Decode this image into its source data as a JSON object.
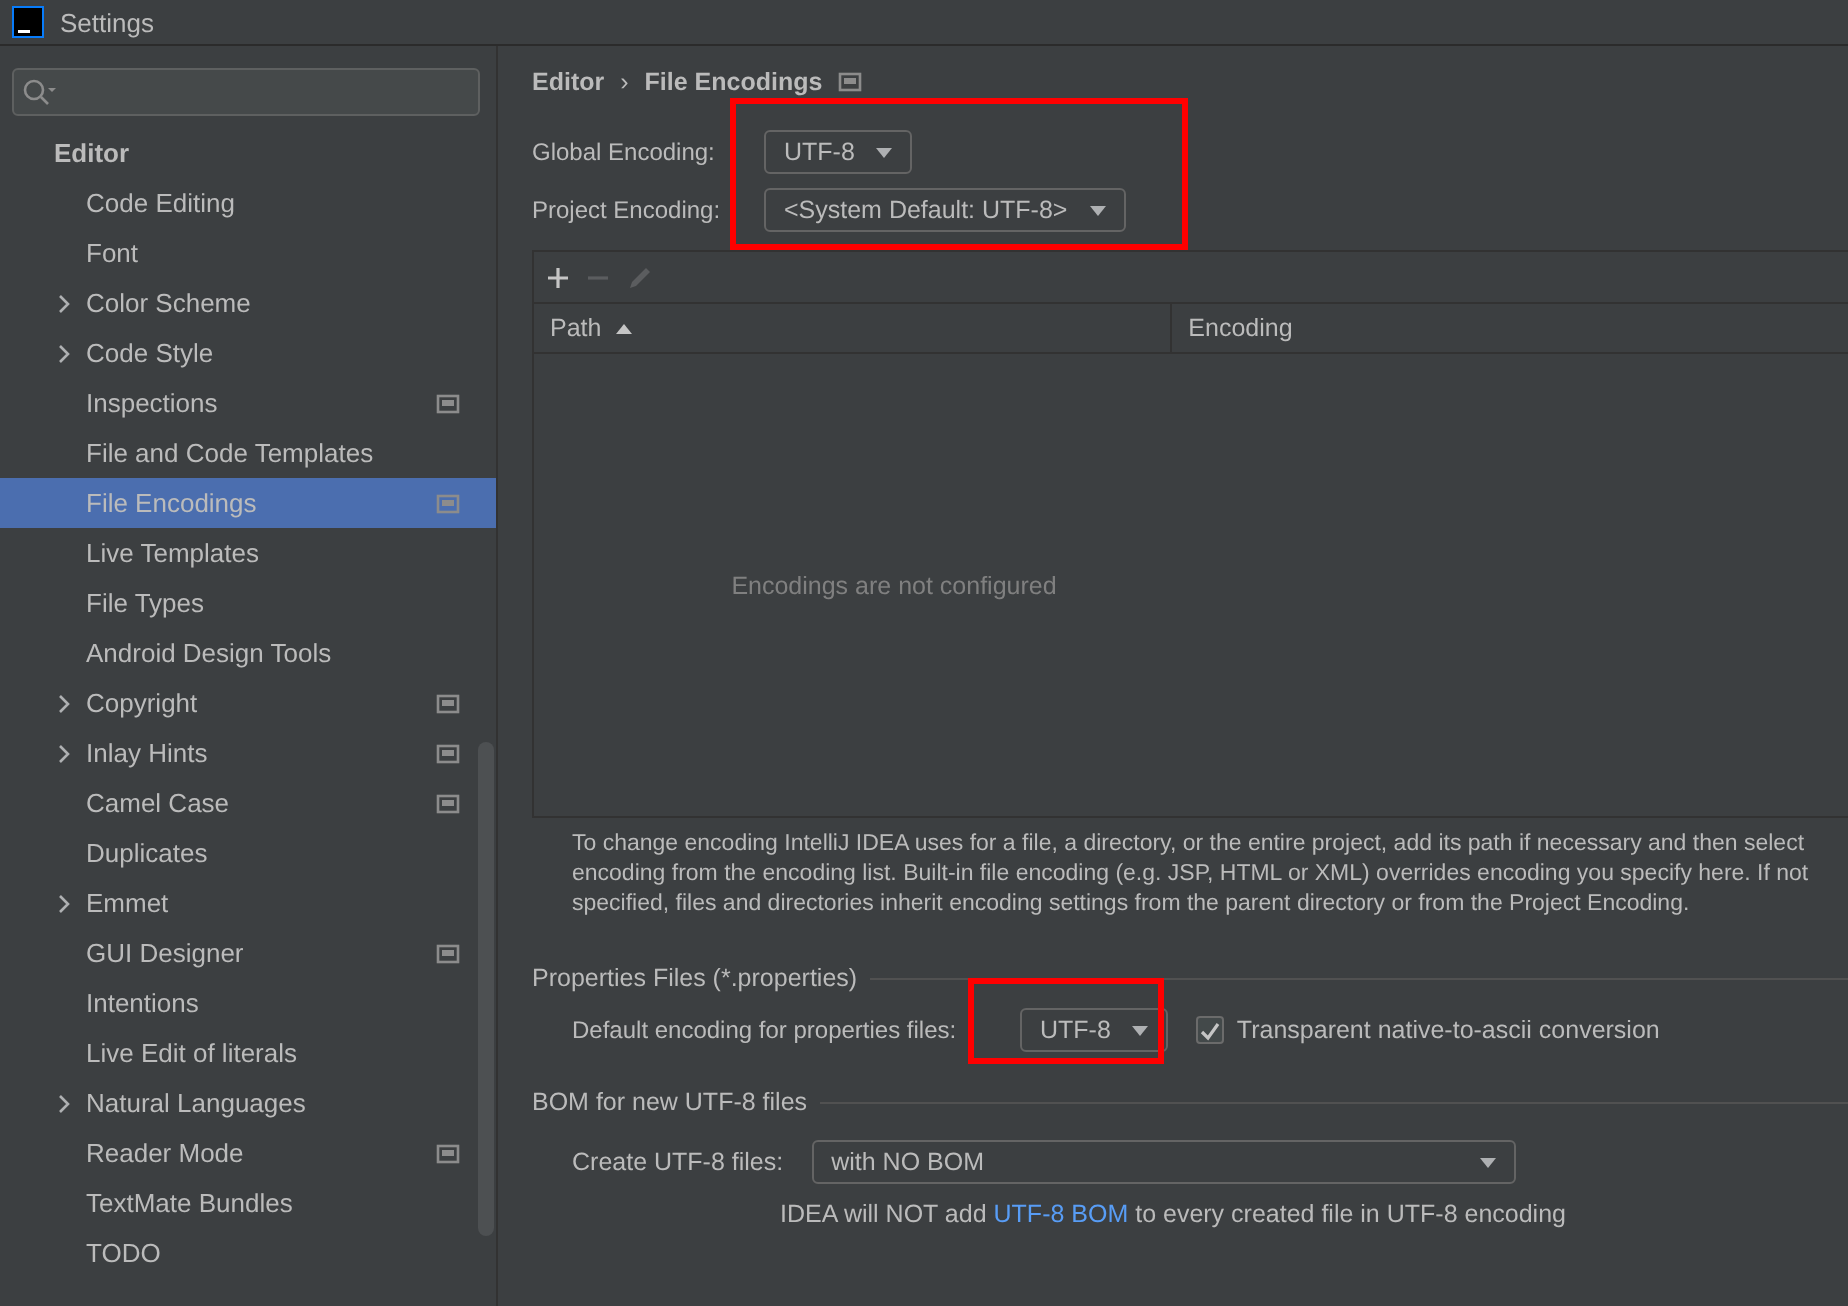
{
  "window": {
    "title": "Settings"
  },
  "sidebar": {
    "items": [
      {
        "label": "Editor",
        "kind": "section",
        "expandable": false,
        "project_icon": false,
        "selected": false
      },
      {
        "label": "Code Editing",
        "kind": "item",
        "expandable": false,
        "project_icon": false,
        "selected": false
      },
      {
        "label": "Font",
        "kind": "item",
        "expandable": false,
        "project_icon": false,
        "selected": false
      },
      {
        "label": "Color Scheme",
        "kind": "item",
        "expandable": true,
        "project_icon": false,
        "selected": false
      },
      {
        "label": "Code Style",
        "kind": "item",
        "expandable": true,
        "project_icon": false,
        "selected": false
      },
      {
        "label": "Inspections",
        "kind": "item",
        "expandable": false,
        "project_icon": true,
        "selected": false
      },
      {
        "label": "File and Code Templates",
        "kind": "item",
        "expandable": false,
        "project_icon": false,
        "selected": false
      },
      {
        "label": "File Encodings",
        "kind": "item",
        "expandable": false,
        "project_icon": true,
        "selected": true
      },
      {
        "label": "Live Templates",
        "kind": "item",
        "expandable": false,
        "project_icon": false,
        "selected": false
      },
      {
        "label": "File Types",
        "kind": "item",
        "expandable": false,
        "project_icon": false,
        "selected": false
      },
      {
        "label": "Android Design Tools",
        "kind": "item",
        "expandable": false,
        "project_icon": false,
        "selected": false
      },
      {
        "label": "Copyright",
        "kind": "item",
        "expandable": true,
        "project_icon": true,
        "selected": false
      },
      {
        "label": "Inlay Hints",
        "kind": "item",
        "expandable": true,
        "project_icon": true,
        "selected": false
      },
      {
        "label": "Camel Case",
        "kind": "item",
        "expandable": false,
        "project_icon": true,
        "selected": false
      },
      {
        "label": "Duplicates",
        "kind": "item",
        "expandable": false,
        "project_icon": false,
        "selected": false
      },
      {
        "label": "Emmet",
        "kind": "item",
        "expandable": true,
        "project_icon": false,
        "selected": false
      },
      {
        "label": "GUI Designer",
        "kind": "item",
        "expandable": false,
        "project_icon": true,
        "selected": false
      },
      {
        "label": "Intentions",
        "kind": "item",
        "expandable": false,
        "project_icon": false,
        "selected": false
      },
      {
        "label": "Live Edit of literals",
        "kind": "item",
        "expandable": false,
        "project_icon": false,
        "selected": false
      },
      {
        "label": "Natural Languages",
        "kind": "item",
        "expandable": true,
        "project_icon": false,
        "selected": false
      },
      {
        "label": "Reader Mode",
        "kind": "item",
        "expandable": false,
        "project_icon": true,
        "selected": false
      },
      {
        "label": "TextMate Bundles",
        "kind": "item",
        "expandable": false,
        "project_icon": false,
        "selected": false
      },
      {
        "label": "TODO",
        "kind": "item",
        "expandable": false,
        "project_icon": false,
        "selected": false
      }
    ]
  },
  "breadcrumb": {
    "parent": "Editor",
    "separator": "›",
    "current": "File Encodings"
  },
  "encodings": {
    "highlighted": true,
    "rows": [
      {
        "label": "Global Encoding:",
        "value": "UTF-8"
      },
      {
        "label": "Project Encoding:",
        "value": "<System Default: UTF-8>"
      }
    ]
  },
  "table": {
    "columns": [
      {
        "label": "Path",
        "sorted": true
      },
      {
        "label": "Encoding",
        "sorted": false
      }
    ],
    "empty_text": "Encodings are not configured"
  },
  "description": "To change encoding IntelliJ IDEA uses for a file, a directory, or the entire project, add its path if necessary and then select encoding from the encoding list. Built-in file encoding (e.g. JSP, HTML or XML) overrides encoding you specify here. If not specified, files and directories inherit encoding settings from the parent directory or from the Project Encoding.",
  "properties": {
    "title": "Properties Files (*.properties)",
    "label": "Default encoding for properties files:",
    "value": "UTF-8",
    "highlighted": true,
    "checkbox": {
      "label": "Transparent native-to-ascii conversion",
      "checked": true
    }
  },
  "bom": {
    "title": "BOM for new UTF-8 files",
    "label": "Create UTF-8 files:",
    "value": "with NO BOM",
    "note_before": "IDEA will NOT add",
    "note_link": "UTF-8 BOM",
    "note_after": "to every created file in UTF-8 encoding"
  }
}
